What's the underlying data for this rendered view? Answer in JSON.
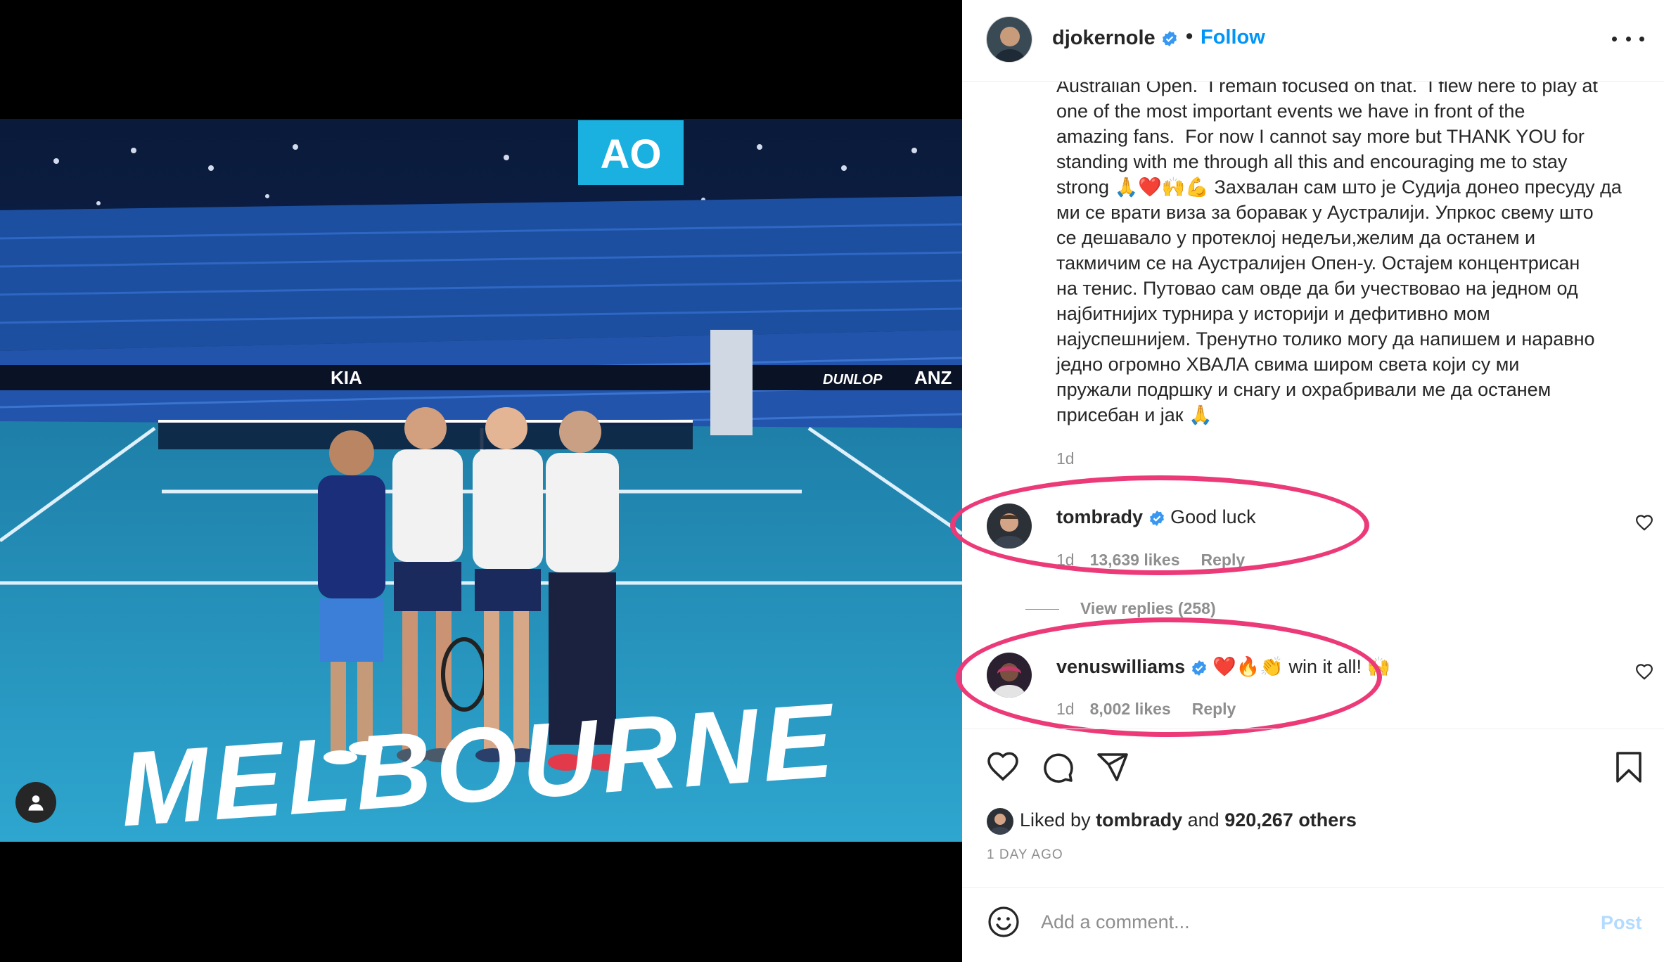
{
  "post": {
    "username": "djokernole",
    "dot": "•",
    "follow_label": "Follow",
    "more_icon": "more-horizontal-icon",
    "caption": "Australian Open.  I remain focused on that.  I flew here to play at\none of the most important events we have in front of the\namazing fans.  For now I cannot say more but THANK YOU for\nstanding with me through all this and encouraging me to stay\nstrong 🙏❤️🙌💪 Захвалан сам што је Судија донео пресуду да\nми се врати виза за боравак у Аустралији. Упркос свему што\nсе дешавало у протеклој недељи,желим да останем и\nтакмичим се на Аустралијен Опен-у. Остајем концентрисан\nна тенис. Путовао сам овде да би учествовао на једном од\nнајбитнијих турнира у историји и дефитивно мом\nнајуспешнијем. Тренутно толико могу да напишем и наравно\nједно огромно ХВАЛА свима широм света који су ми\nпружали подршку и снагу и охрабривали ме да останем\nприсебан и јак 🙏",
    "caption_time": "1d"
  },
  "photo": {
    "scoreboard_text": "AO",
    "court_text": "MELBOURNE",
    "sponsor_left": "KIA",
    "sponsor_right": "DUNLOP",
    "sponsor_anz": "ANZ"
  },
  "comments": [
    {
      "username": "tombrady",
      "text": "Good luck",
      "time": "1d",
      "likes": "13,639 likes",
      "reply_label": "Reply",
      "highlighted": true
    },
    {
      "username": "venuswilliams",
      "text": "❤️🔥👏 win it all! 🙌",
      "time": "1d",
      "likes": "8,002 likes",
      "reply_label": "Reply",
      "highlighted": true
    }
  ],
  "view_replies_label": "View replies (258)",
  "actions": {
    "icons": [
      "heart-icon",
      "comment-icon",
      "share-icon",
      "bookmark-icon"
    ],
    "liked_by_prefix": "Liked by",
    "liked_by_user": "tombrady",
    "liked_by_and": "and",
    "liked_by_others": "920,267 others",
    "post_time": "1 DAY AGO"
  },
  "add_comment": {
    "placeholder": "Add a comment...",
    "post_label": "Post"
  },
  "colors": {
    "accent": "#0095f6",
    "highlight": "#ec3a79",
    "verified": "#3897f0",
    "court": "#2a9bc0"
  }
}
